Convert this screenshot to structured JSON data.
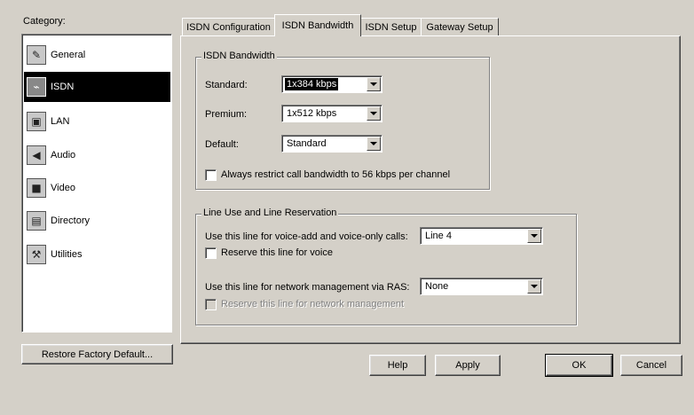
{
  "category": {
    "label": "Category:",
    "items": [
      {
        "label": "General",
        "icon": "notepad-icon"
      },
      {
        "label": "ISDN",
        "icon": "isdn-cable-icon"
      },
      {
        "label": "LAN",
        "icon": "network-computers-icon"
      },
      {
        "label": "Audio",
        "icon": "speaker-icon"
      },
      {
        "label": "Video",
        "icon": "camera-icon"
      },
      {
        "label": "Directory",
        "icon": "book-icon"
      },
      {
        "label": "Utilities",
        "icon": "tools-icon"
      }
    ],
    "selected": "ISDN"
  },
  "restore_button": "Restore Factory Default...",
  "tabs": [
    {
      "label": "ISDN Configuration"
    },
    {
      "label": "ISDN Bandwidth"
    },
    {
      "label": "ISDN Setup"
    },
    {
      "label": "Gateway Setup"
    }
  ],
  "active_tab": "ISDN Bandwidth",
  "bandwidth_group": {
    "title": "ISDN Bandwidth",
    "standard": {
      "label": "Standard:",
      "value": "1x384 kbps"
    },
    "premium": {
      "label": "Premium:",
      "value": "1x512 kbps"
    },
    "default": {
      "label": "Default:",
      "value": "Standard"
    },
    "restrict_checkbox": {
      "label": "Always restrict call bandwidth to 56 kbps per channel",
      "checked": false
    }
  },
  "line_group": {
    "title": "Line Use and Line Reservation",
    "voice_line": {
      "label": "Use this line for voice-add and voice-only calls:",
      "value": "Line 4"
    },
    "reserve_voice": {
      "label": "Reserve this line for voice",
      "checked": false
    },
    "ras_line": {
      "label": "Use this line for network management via RAS:",
      "value": "None"
    },
    "reserve_mgmt": {
      "label": "Reserve this line for network management",
      "checked": false,
      "enabled": false
    }
  },
  "buttons": {
    "help": "Help",
    "apply": "Apply",
    "ok": "OK",
    "cancel": "Cancel"
  }
}
